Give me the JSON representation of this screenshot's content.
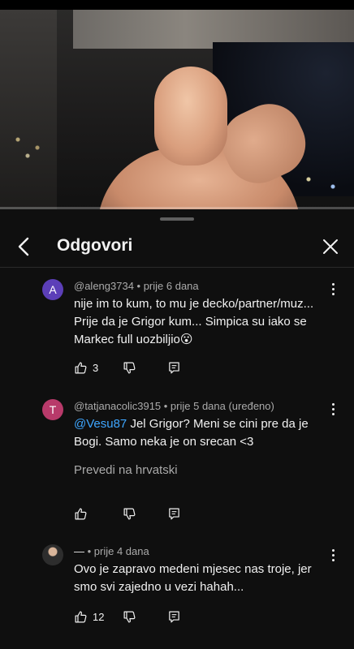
{
  "header": {
    "title": "Odgovori"
  },
  "comments": [
    {
      "avatar_letter": "A",
      "avatar_color": "#5c3fb8",
      "meta": "@aleng3734 • prije 6 dana",
      "text": "nije im to kum, to mu je decko/partner/muz... Prije da je Grigor kum... Simpica su iako se Markec full uozbiljio",
      "emoji": "😮",
      "likes": "3"
    },
    {
      "avatar_letter": "T",
      "avatar_color": "#b83a6a",
      "meta": "@tatjanacolic3915 • prije 5 dana (uređeno)",
      "mention": "@Vesu87",
      "text": " Jel Grigor? Meni se cini pre da je Bogi. Samo neka je on srecan <3",
      "translate": "Prevedi na hrvatski",
      "likes": ""
    },
    {
      "avatar_color": "#3a3a3a",
      "meta_name": "—",
      "meta": " • prije 4 dana",
      "text": "Ovo je zapravo medeni mjesec nas troje, jer smo svi zajedno u vezi hahah...",
      "likes": "12"
    }
  ],
  "icons": {
    "back": "chevron-left-icon",
    "close": "close-icon",
    "like": "thumbs-up-icon",
    "dislike": "thumbs-down-icon",
    "reply": "reply-icon",
    "more": "more-vertical-icon"
  }
}
